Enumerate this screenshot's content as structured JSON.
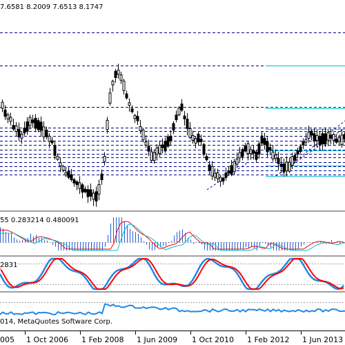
{
  "main_pane": {
    "ohlc_label": "7.6581 8.2009 7.6513 8.1747"
  },
  "macd_pane": {
    "label": "55 0.283214 0.480091"
  },
  "stoch_pane": {
    "label": "2831"
  },
  "footer": {
    "copyright": "014, MetaQuotes Software Corp."
  },
  "time_axis": {
    "labels": [
      "005",
      "1 Oct 2006",
      "1 Feb 2008",
      "1 Jun 2009",
      "1 Oct 2010",
      "1 Feb 2012",
      "1 Jun 2013"
    ]
  },
  "colors": {
    "candles": "#000000",
    "levels": "#00008b",
    "channel": "#00bcd4",
    "macd_histogram": "#1e5bd6",
    "macd_signal": "#ff0000",
    "stoch_main": "#1e88e5",
    "stoch_signal": "#ff0000",
    "lower_line": "#1e88e5"
  }
}
